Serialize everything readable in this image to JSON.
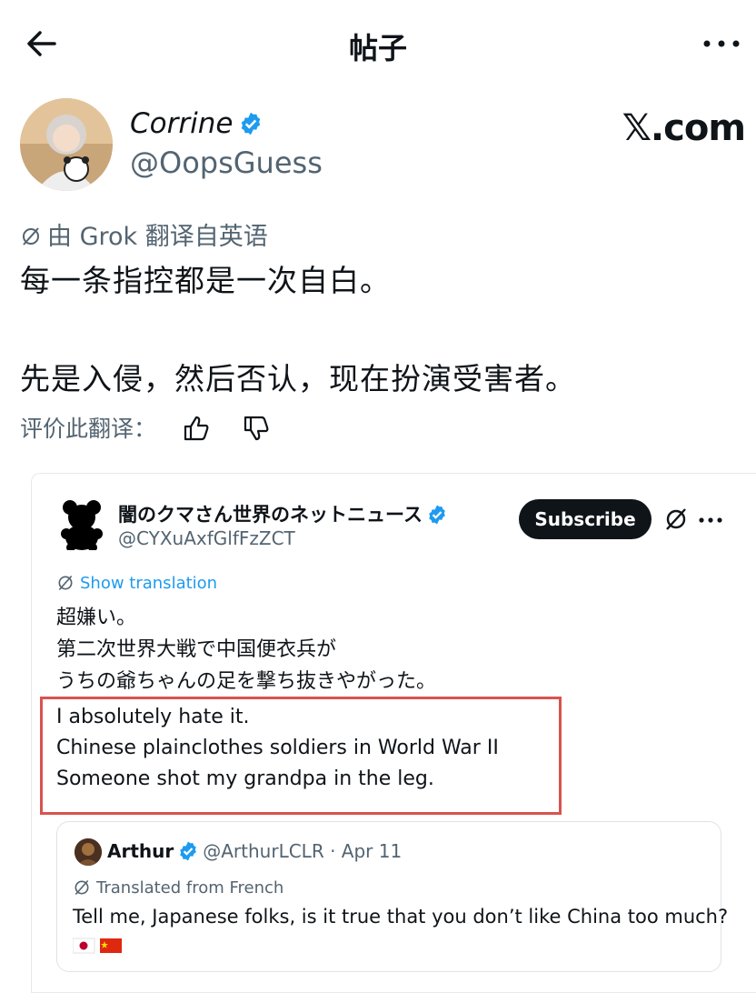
{
  "topbar": {
    "title": "帖子"
  },
  "post": {
    "author_name": "Corrine",
    "author_handle": "@OopsGuess",
    "source_mark": "𝕏.com",
    "translated_note": "由 Grok 翻译自英语",
    "text_line1": "每一条指控都是一次自白。",
    "text_line2": "先是入侵，然后否认，现在扮演受害者。",
    "rate_label": "评价此翻译："
  },
  "embedded": {
    "name": "闇のクマさん世界のネットニュース",
    "handle": "@CYXuAxfGlfFzZCT",
    "subscribe_label": "Subscribe",
    "show_translation": "Show translation",
    "jp_lines": [
      "超嫌い。",
      "第二次世界大戦で中国便衣兵が",
      "うちの爺ちゃんの足を撃ち抜きやがった。"
    ],
    "en_lines": [
      "I absolutely hate it.",
      "Chinese plainclothes soldiers in World War II",
      "Someone shot my grandpa in the leg."
    ],
    "highlight_color": "#d9534f"
  },
  "quote": {
    "name": "Arthur",
    "meta": "@ArthurLCLR · Apr 11",
    "translated_note": "Translated from French",
    "text": "Tell me, Japanese folks, is it true that you don’t like China too much?"
  },
  "colors": {
    "verified": "#1d9bf0",
    "secondary": "#536471",
    "text": "#0f1419"
  },
  "icons": [
    "back-arrow-icon",
    "more-icon",
    "verified-icon",
    "grok-icon",
    "thumbs-up-icon",
    "thumbs-down-icon",
    "bear-icon",
    "flag-icon"
  ]
}
